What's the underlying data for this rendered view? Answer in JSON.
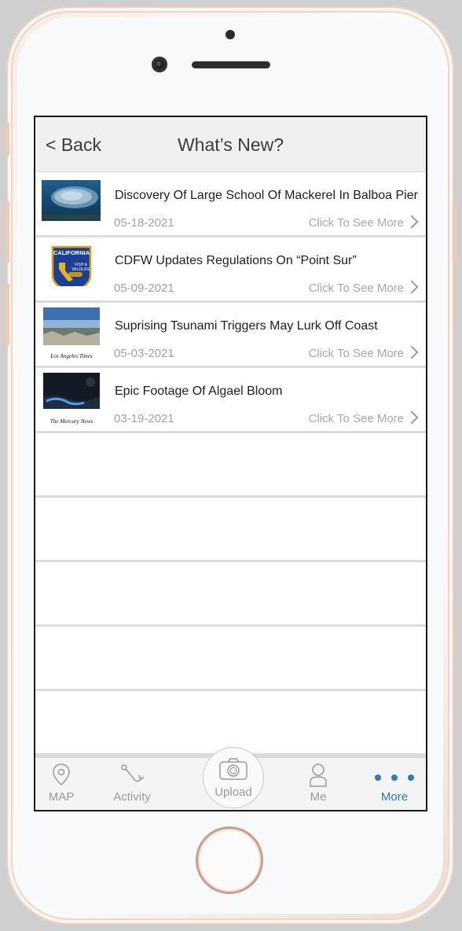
{
  "navbar": {
    "back_label": "< Back",
    "title": "What’s New?"
  },
  "news": [
    {
      "title": "Discovery Of Large School Of Mackerel In Balboa Pier",
      "date": "05-18-2021",
      "more": "Click To See More",
      "thumb_icon": "fish-school-photo"
    },
    {
      "title": "CDFW Updates Regulations On “Point Sur”",
      "date": "05-09-2021",
      "more": "Click To See More",
      "thumb_icon": "cdfw-badge-logo",
      "badge_text": [
        "CALIFORNIA",
        "FISH &",
        "WILDLIFE"
      ]
    },
    {
      "title": "Suprising Tsunami Triggers May Lurk Off Coast",
      "date": "05-03-2021",
      "more": "Click To See More",
      "thumb_icon": "coast-photo",
      "source": "Los Angeles Times"
    },
    {
      "title": "Epic Footage Of Algael Bloom",
      "date": "03-19-2021",
      "more": "Click To See More",
      "thumb_icon": "night-wave-photo",
      "source": "The Mercury News"
    }
  ],
  "tabbar": {
    "items": [
      {
        "label": "MAP",
        "icon": "map-pin-icon"
      },
      {
        "label": "Activity",
        "icon": "fishing-hook-icon"
      },
      {
        "label": "Upload",
        "icon": "camera-icon"
      },
      {
        "label": "Me",
        "icon": "person-icon"
      },
      {
        "label": "More",
        "icon": "more-dots-icon"
      }
    ],
    "active_color": "#2f7ac5",
    "inactive_color": "#9a9a9a"
  }
}
